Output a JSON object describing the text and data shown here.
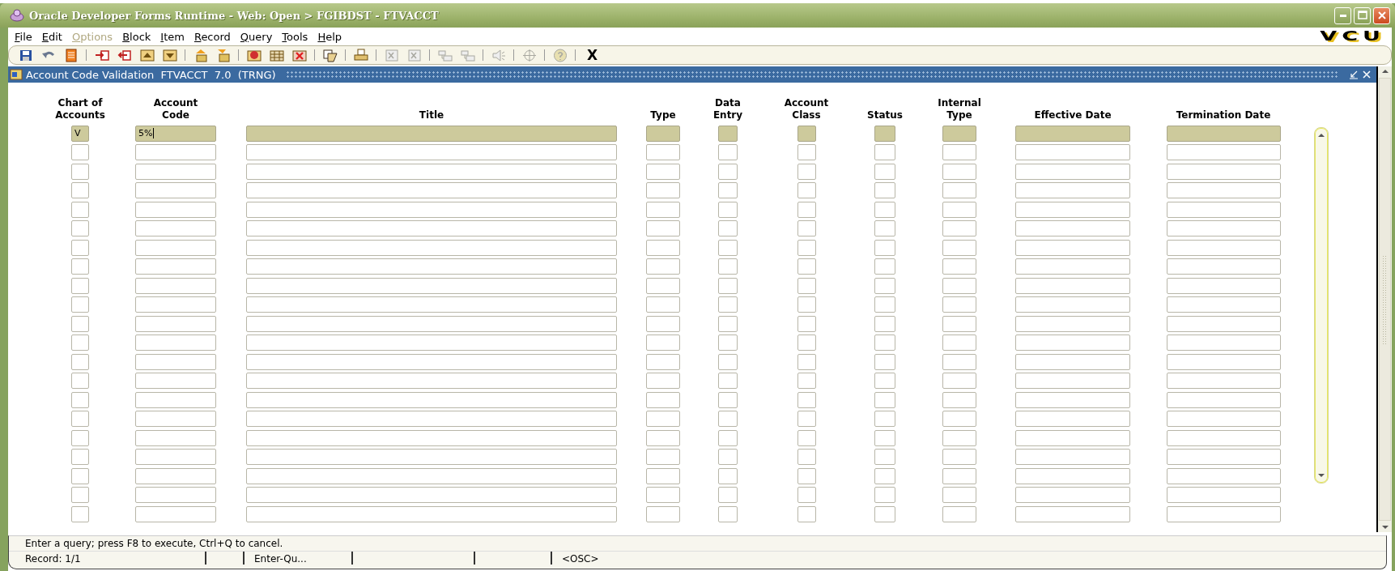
{
  "window": {
    "title": "Oracle Developer Forms Runtime - Web:  Open > FGIBDST - FTVACCT"
  },
  "menu": [
    {
      "label": "File",
      "disabled": false
    },
    {
      "label": "Edit",
      "disabled": false
    },
    {
      "label": "Options",
      "disabled": true
    },
    {
      "label": "Block",
      "disabled": false
    },
    {
      "label": "Item",
      "disabled": false
    },
    {
      "label": "Record",
      "disabled": false
    },
    {
      "label": "Query",
      "disabled": false
    },
    {
      "label": "Tools",
      "disabled": false
    },
    {
      "label": "Help",
      "disabled": false
    }
  ],
  "logo": "VCU",
  "toolbar": [
    {
      "kind": "save",
      "disabled": false
    },
    {
      "kind": "undo",
      "disabled": false
    },
    {
      "kind": "document",
      "disabled": false
    },
    {
      "kind": "separator"
    },
    {
      "kind": "insert",
      "disabled": false
    },
    {
      "kind": "remove",
      "disabled": false
    },
    {
      "kind": "up",
      "disabled": false
    },
    {
      "kind": "down",
      "disabled": false
    },
    {
      "kind": "separator"
    },
    {
      "kind": "query",
      "disabled": false
    },
    {
      "kind": "execute",
      "disabled": false
    },
    {
      "kind": "separator"
    },
    {
      "kind": "ask",
      "disabled": false
    },
    {
      "kind": "grid",
      "disabled": false
    },
    {
      "kind": "cancel",
      "disabled": false
    },
    {
      "kind": "separator"
    },
    {
      "kind": "copy",
      "disabled": false
    },
    {
      "kind": "separator"
    },
    {
      "kind": "printer",
      "disabled": false
    },
    {
      "kind": "separator"
    },
    {
      "kind": "sheet",
      "disabled": true
    },
    {
      "kind": "sheet",
      "disabled": true
    },
    {
      "kind": "separator"
    },
    {
      "kind": "blocks",
      "disabled": true
    },
    {
      "kind": "blocks",
      "disabled": true
    },
    {
      "kind": "separator"
    },
    {
      "kind": "speaker",
      "disabled": true
    },
    {
      "kind": "separator"
    },
    {
      "kind": "target",
      "disabled": true
    },
    {
      "kind": "separator"
    },
    {
      "kind": "help",
      "disabled": true
    },
    {
      "kind": "separator"
    },
    {
      "kind": "text",
      "text": "X"
    }
  ],
  "form": {
    "title": "Account Code Validation  FTVACCT  7.0  (TRNG)",
    "columns": [
      {
        "label": "Chart of\nAccounts"
      },
      {
        "label": "Account\nCode"
      },
      {
        "label": "Title"
      },
      {
        "label": "Type"
      },
      {
        "label": "Data\nEntry"
      },
      {
        "label": "Account\nClass"
      },
      {
        "label": "Status"
      },
      {
        "label": "Internal\nType"
      },
      {
        "label": "Effective Date"
      },
      {
        "label": "Termination Date"
      }
    ],
    "rows": [
      {
        "current": true,
        "cursor": true,
        "values": [
          "V",
          "5%"
        ]
      },
      {
        "current": false
      },
      {
        "current": false
      },
      {
        "current": false
      },
      {
        "current": false
      },
      {
        "current": false
      },
      {
        "current": false
      },
      {
        "current": false
      },
      {
        "current": false
      },
      {
        "current": false
      },
      {
        "current": false
      },
      {
        "current": false
      },
      {
        "current": false
      },
      {
        "current": false
      },
      {
        "current": false
      },
      {
        "current": false
      },
      {
        "current": false
      },
      {
        "current": false
      },
      {
        "current": false
      },
      {
        "current": false
      },
      {
        "current": false
      }
    ]
  },
  "status_bar": {
    "message": "Enter a query;  press F8 to execute, Ctrl+Q to cancel.",
    "fields": [
      {
        "kind": "text",
        "text": "Record: 1/1"
      },
      {
        "kind": "blank"
      },
      {
        "kind": "text",
        "text": "Enter-Qu..."
      },
      {
        "kind": "blank"
      },
      {
        "kind": "blank"
      },
      {
        "kind": "text",
        "text": "<OSC>"
      }
    ]
  }
}
